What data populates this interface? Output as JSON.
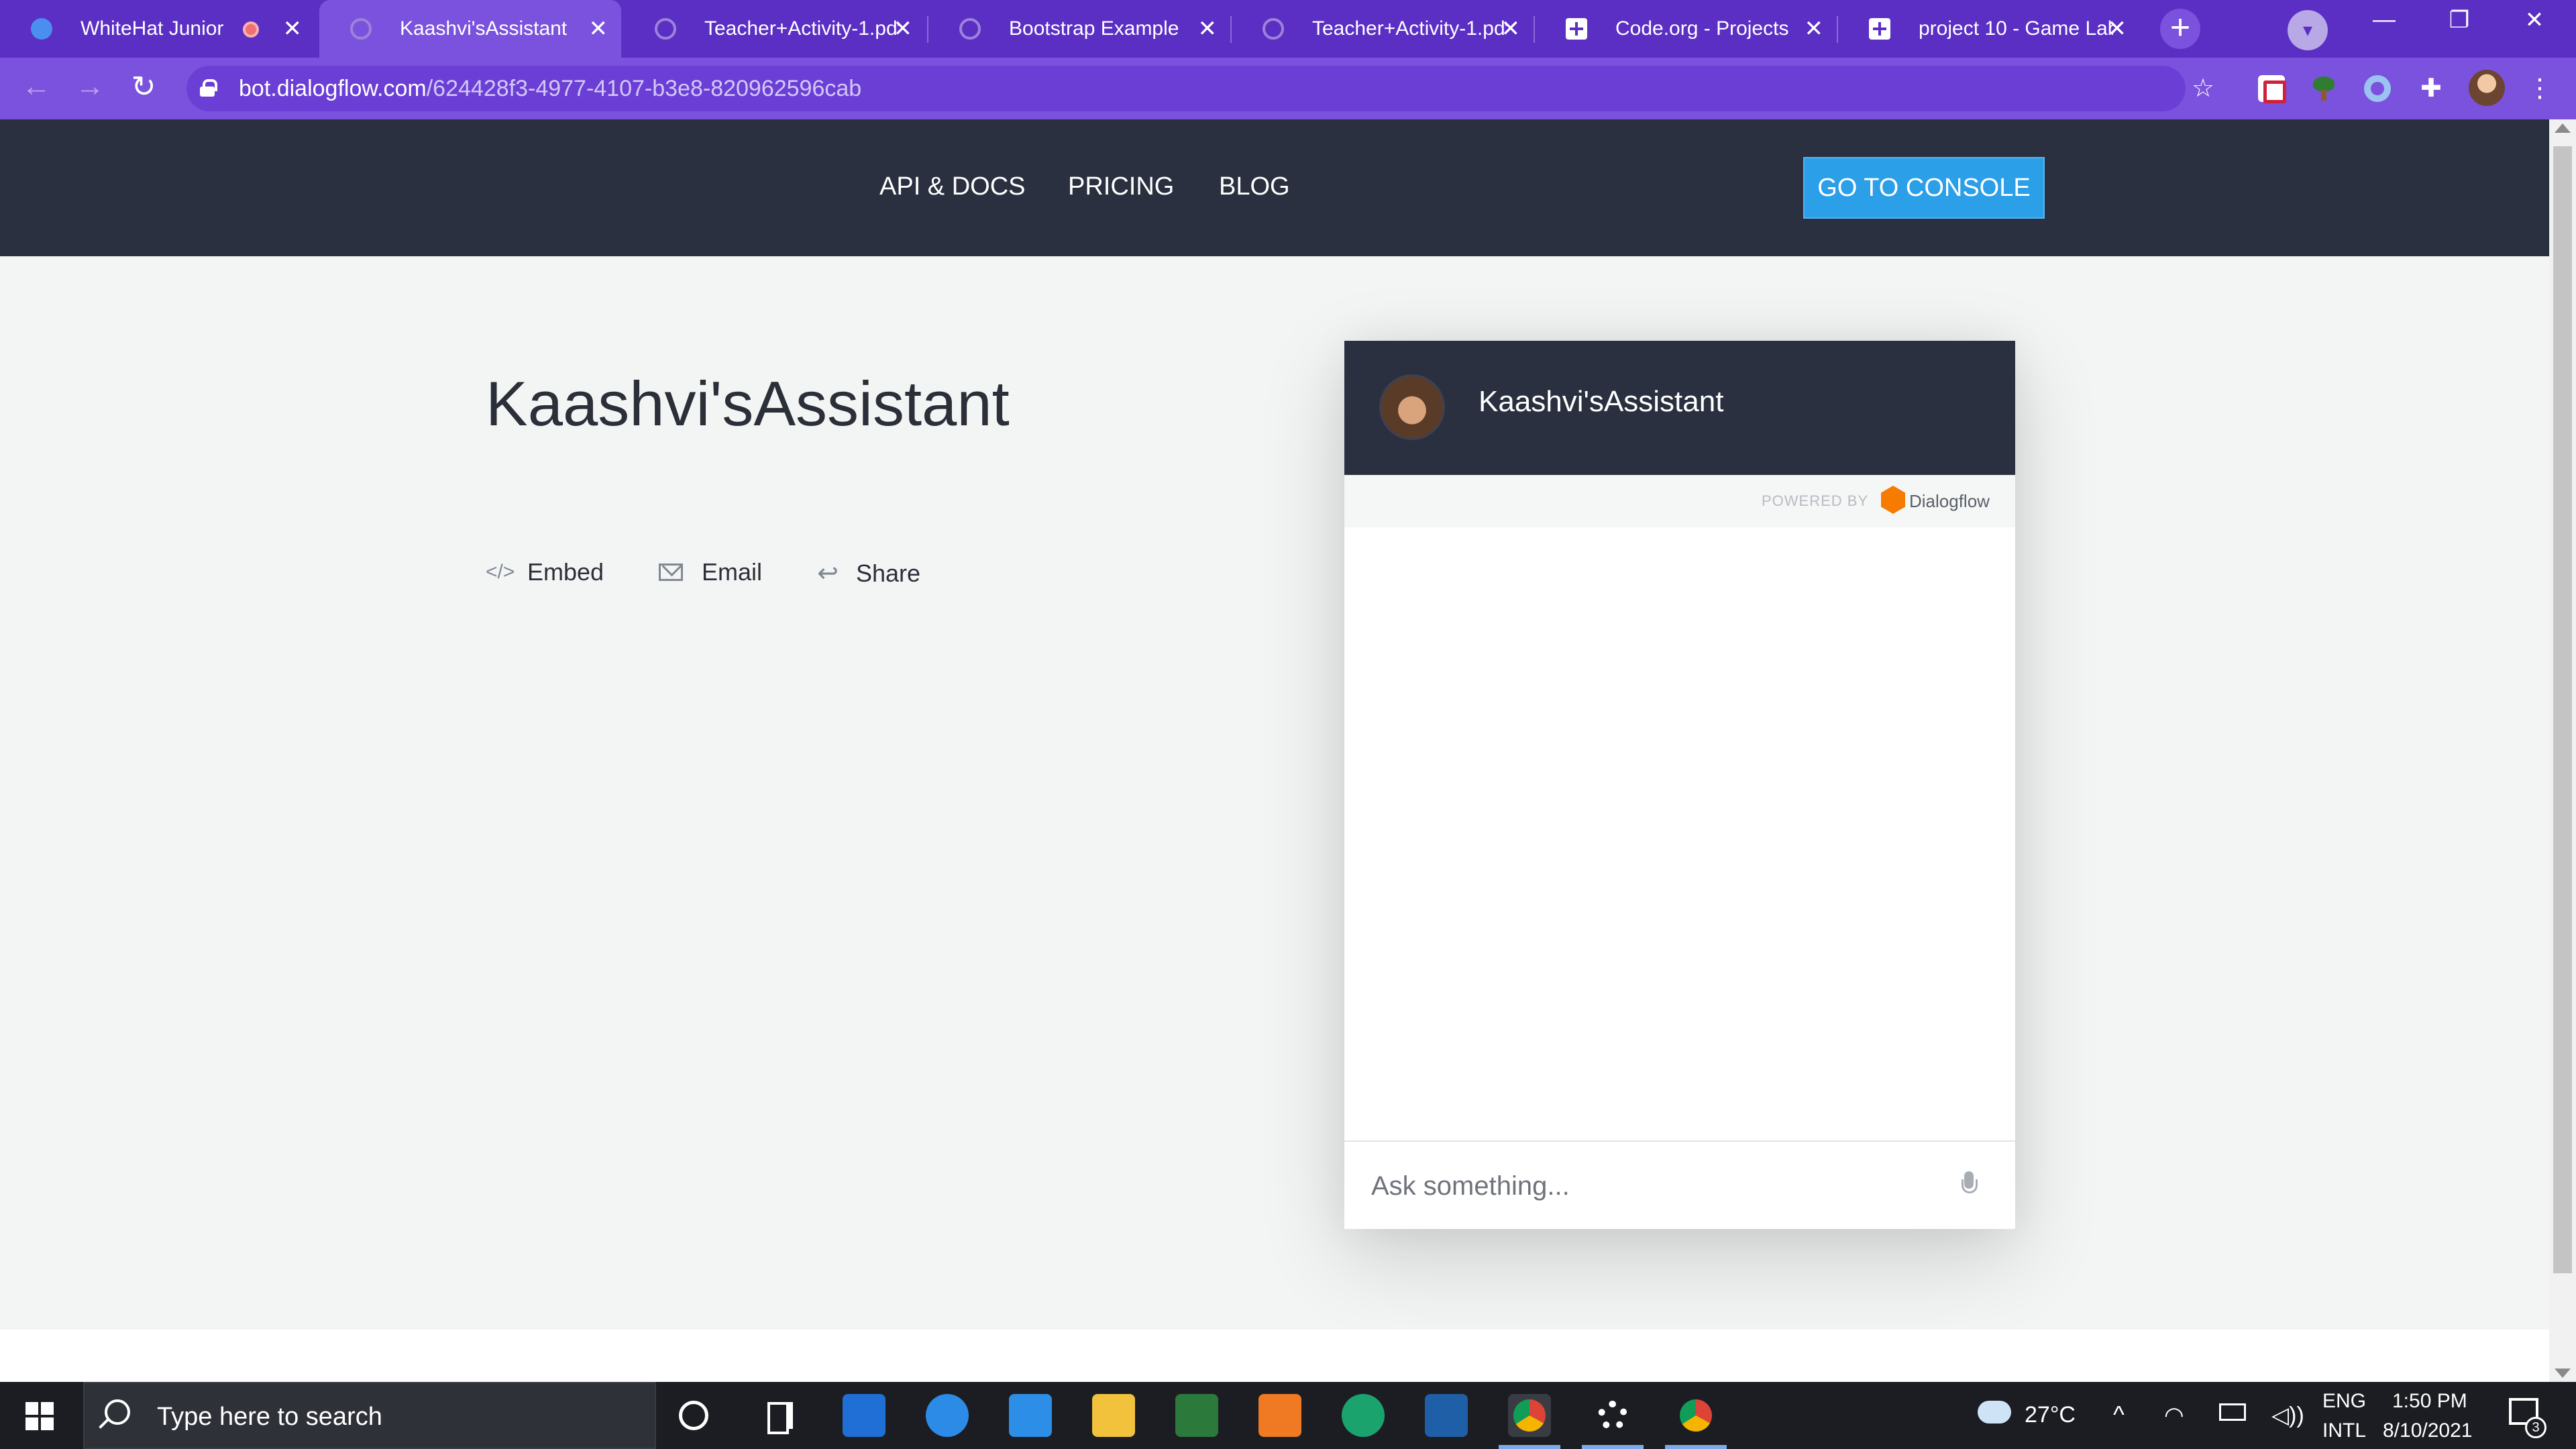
{
  "browser": {
    "tabs": [
      {
        "title": "WhiteHat Junior",
        "recording": true
      },
      {
        "title": "Kaashvi'sAssistant"
      },
      {
        "title": "Teacher+Activity-1.pdf"
      },
      {
        "title": "Bootstrap Example"
      },
      {
        "title": "Teacher+Activity-1.pdf"
      },
      {
        "title": "Code.org - Projects"
      },
      {
        "title": "project 10 - Game Lab"
      }
    ],
    "new_tab": "+",
    "close_glyph": "✕",
    "url_host": "bot.dialogflow.com",
    "url_path": "/624428f3-4977-4107-b3e8-820962596cab",
    "icons": {
      "back": "←",
      "forward": "→",
      "reload": "↻",
      "star": "☆",
      "puzzle": "✚",
      "kebab": "⋮",
      "minimize": "—",
      "restore": "❐",
      "window_close": "✕",
      "profile_drop": "▾"
    }
  },
  "header": {
    "nav": [
      "API & DOCS",
      "PRICING",
      "BLOG"
    ],
    "console_button": "GO TO CONSOLE"
  },
  "main": {
    "bot_title": "Kaashvi'sAssistant",
    "actions": [
      "Embed",
      "Email",
      "Share"
    ],
    "action_icons": {
      "embed": "</>",
      "share": "↩"
    }
  },
  "chat": {
    "bot_name": "Kaashvi'sAssistant",
    "powered_by": "POWERED BY",
    "brand": "Dialogflow",
    "input_placeholder": "Ask something..."
  },
  "taskbar": {
    "search_placeholder": "Type here to search",
    "weather": "27°C",
    "chevron": "^",
    "lang_top": "ENG",
    "lang_bottom": "INTL",
    "time": "1:50 PM",
    "date": "8/10/2021",
    "notifications": "3",
    "colors": {
      "accent": "#5b2fc4",
      "console_blue": "#2b9fe8",
      "header_dark": "#2a303f"
    }
  }
}
